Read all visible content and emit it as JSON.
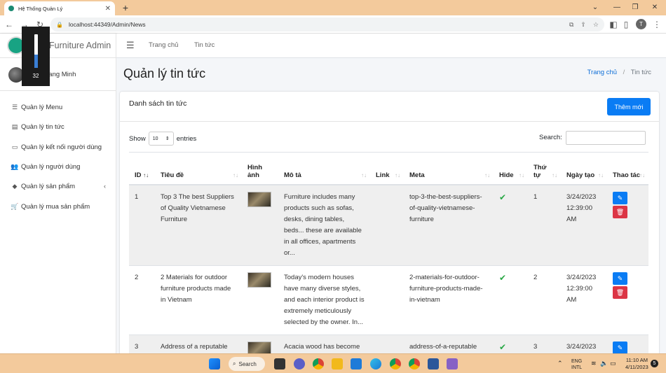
{
  "browser": {
    "tab_title": "Hệ Thống Quản Lý",
    "url": "localhost:44349/Admin/News",
    "profile_initial": "T"
  },
  "sidebar": {
    "brand": "Furniture Admin",
    "user_name": "uang Minh",
    "items": [
      {
        "label": "Quản lý Menu",
        "icon": "list-icon"
      },
      {
        "label": "Quản lý tin tức",
        "icon": "newspaper-icon"
      },
      {
        "label": "Quản lý kết nối người dùng",
        "icon": "window-icon"
      },
      {
        "label": "Quản lý người dùng",
        "icon": "users-icon"
      },
      {
        "label": "Quản lý sản phẩm",
        "icon": "cube-icon",
        "has_children": true
      },
      {
        "label": "Quản lý mua sản phẩm",
        "icon": "cart-icon"
      }
    ]
  },
  "overlay": {
    "value": "32",
    "level": 0.4
  },
  "topnav": {
    "home": "Trang chủ",
    "news": "Tin tức"
  },
  "page": {
    "title": "Quản lý tin tức",
    "breadcrumb_home": "Trang chủ",
    "breadcrumb_sep": "/",
    "breadcrumb_current": "Tin tức"
  },
  "card": {
    "title": "Danh sách tin tức",
    "add_button": "Thêm mới",
    "show_label": "Show",
    "entries_value": "10",
    "entries_label": "entries",
    "search_label": "Search:"
  },
  "table": {
    "columns": [
      "ID",
      "Tiêu đề",
      "Hình ảnh",
      "Mô tả",
      "Link",
      "Meta",
      "Hide",
      "Thứ tự",
      "Ngày tạo",
      "Thao tác"
    ],
    "rows": [
      {
        "id": "1",
        "title": "Top 3 The best Suppliers of Quality Vietnamese Furniture",
        "desc": "Furniture includes many products such as sofas, desks, dining tables, beds... these are available in all offices, apartments or...",
        "link": "",
        "meta": "top-3-the-best-suppliers-of-quality-vietnamese-furniture",
        "hide": true,
        "order": "1",
        "created": "3/24/2023 12:39:00 AM"
      },
      {
        "id": "2",
        "title": "2 Materials for outdoor furniture products made in Vietnam",
        "desc": "Today's modern houses have many diverse styles, and each interior product is extremely meticulously selected by the owner. In...",
        "link": "",
        "meta": "2-materials-for-outdoor-furniture-products-made-in-vietnam",
        "hide": true,
        "order": "2",
        "created": "3/24/2023 12:39:00 AM"
      },
      {
        "id": "3",
        "title": "Address of a reputable",
        "desc": "Acacia wood has become",
        "link": "",
        "meta": "address-of-a-reputable",
        "hide": true,
        "order": "3",
        "created": "3/24/2023"
      }
    ]
  },
  "taskbar": {
    "search": "Search",
    "lang1": "ENG",
    "lang2": "INTL",
    "time": "11:10 AM",
    "date": "4/11/2023",
    "badge": "5"
  }
}
